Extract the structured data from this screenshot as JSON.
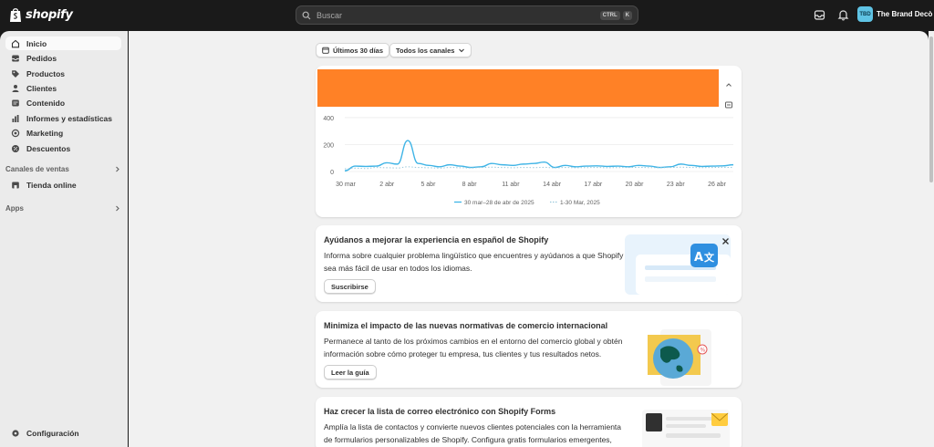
{
  "topbar": {
    "logo_text": "shopify",
    "search_placeholder": "Buscar",
    "shortcut_keys": [
      "CTRL",
      "K"
    ],
    "store_initials": "TBD",
    "store_name": "The Brand Decò"
  },
  "sidebar": {
    "items": [
      {
        "label": "Inicio",
        "icon": "home-icon",
        "active": true
      },
      {
        "label": "Pedidos",
        "icon": "orders-icon"
      },
      {
        "label": "Productos",
        "icon": "tag-icon"
      },
      {
        "label": "Clientes",
        "icon": "person-icon"
      },
      {
        "label": "Contenido",
        "icon": "content-icon"
      },
      {
        "label": "Informes y estadísticas",
        "icon": "bar-chart-icon"
      },
      {
        "label": "Marketing",
        "icon": "target-icon"
      },
      {
        "label": "Descuentos",
        "icon": "discount-icon"
      }
    ],
    "sales_channels_label": "Canales de ventas",
    "online_store_label": "Tienda online",
    "apps_label": "Apps",
    "settings_label": "Configuración"
  },
  "filters": {
    "date_range": "Últimos 30 días",
    "channels": "Todos los canales"
  },
  "chart_data": {
    "type": "line",
    "x": [
      "30 mar",
      "2 abr",
      "5 abr",
      "8 abr",
      "11 abr",
      "14 abr",
      "17 abr",
      "20 abr",
      "23 abr",
      "26 abr"
    ],
    "yticks": [
      0,
      200,
      400
    ],
    "ylim": [
      0,
      420
    ],
    "series": [
      {
        "name": "30 mar–28 de abr de 2025",
        "style": "solid",
        "color": "#3fb4e6",
        "values": [
          5,
          40,
          38,
          40,
          65,
          55,
          230,
          60,
          45,
          35,
          50,
          40,
          30,
          35,
          60,
          50,
          45,
          55,
          60,
          70,
          30,
          45,
          35,
          40,
          42,
          38,
          40,
          35,
          45,
          40,
          30,
          35,
          55,
          45,
          38,
          40,
          42,
          50
        ]
      },
      {
        "name": "1-30 Mar, 2025",
        "style": "dotted",
        "color": "#9bc9dc",
        "values": [
          20,
          25,
          22,
          30,
          28,
          26,
          35,
          30,
          28,
          25,
          30,
          28,
          26,
          30,
          32,
          30,
          28,
          30,
          29,
          31,
          27,
          30,
          28,
          29,
          30,
          28,
          29,
          30,
          31,
          29,
          28,
          30,
          32,
          30,
          29,
          30,
          31,
          30
        ]
      }
    ]
  },
  "cards": [
    {
      "title": "Ayúdanos a mejorar la experiencia en español de Shopify",
      "body": "Informa sobre cualquier problema lingüístico que encuentres y ayúdanos a que Shopify sea más fácil de usar en todos los idiomas.",
      "button": "Suscribirse"
    },
    {
      "title": "Minimiza el impacto de las nuevas normativas de comercio internacional",
      "body": "Permanece al tanto de los próximos cambios en el entorno del comercio global y obtén información sobre cómo proteger tu empresa, tus clientes y tus resultados netos.",
      "button": "Leer la guía"
    },
    {
      "title": "Haz crecer la lista de correo electrónico con Shopify Forms",
      "body": "Amplía la lista de contactos y convierte nuevos clientes potenciales con la herramienta de formularios personalizables de Shopify. Configura gratis formularios emergentes, superpuestos y en línea."
    }
  ],
  "colors": {
    "accent_orange": "#ff8126",
    "line_blue": "#3fb4e6"
  }
}
